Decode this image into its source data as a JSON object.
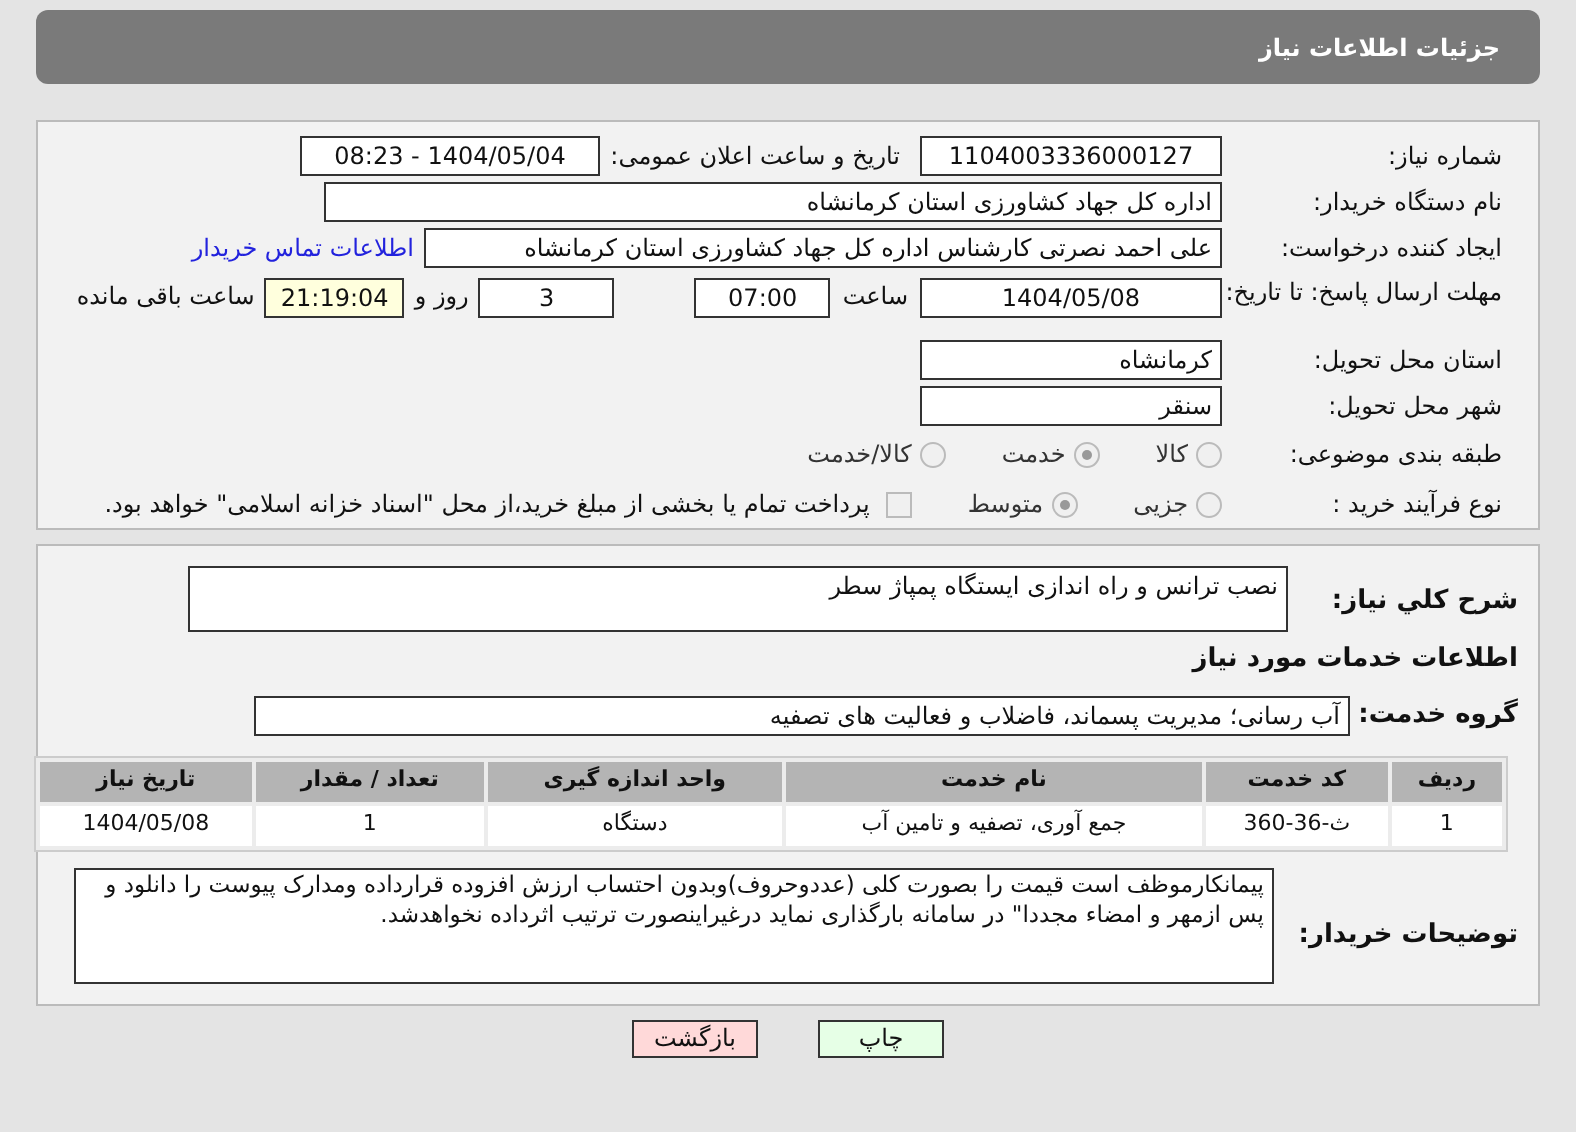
{
  "header": {
    "title": "جزئیات اطلاعات نیاز"
  },
  "need_number": {
    "label": "شماره نیاز:",
    "value": "1104003336000127"
  },
  "announce": {
    "label": "تاریخ و ساعت اعلان عمومی:",
    "value": "1404/05/04 - 08:23"
  },
  "buyer": {
    "label": "نام دستگاه خریدار:",
    "value": "اداره کل جهاد کشاورزی استان کرمانشاه"
  },
  "requester": {
    "label": "ایجاد کننده درخواست:",
    "value": "علی احمد نصرتی کارشناس اداره کل جهاد کشاورزی استان کرمانشاه",
    "link": "اطلاعات تماس خریدار"
  },
  "deadline": {
    "label": "مهلت ارسال پاسخ: تا تاریخ:",
    "date": "1404/05/08",
    "time_label": "ساعت",
    "time": "07:00",
    "days": "3",
    "days_label": "روز و",
    "remaining": "21:19:04",
    "remaining_label": "ساعت باقی مانده"
  },
  "province": {
    "label": "استان محل تحویل:",
    "value": "کرمانشاه"
  },
  "city": {
    "label": "شهر محل تحویل:",
    "value": "سنقر"
  },
  "category": {
    "label": "طبقه بندی موضوعی:",
    "options": [
      {
        "label": "کالا",
        "selected": false
      },
      {
        "label": "خدمت",
        "selected": true
      },
      {
        "label": "کالا/خدمت",
        "selected": false
      }
    ]
  },
  "process": {
    "label": "نوع فرآیند خرید :",
    "options": [
      {
        "label": "جزیی",
        "selected": false
      },
      {
        "label": "متوسط",
        "selected": true
      }
    ],
    "payment": {
      "label": "پرداخت تمام یا بخشی از مبلغ خرید،از محل \"اسناد خزانه اسلامی\" خواهد بود.",
      "checked": false
    }
  },
  "description": {
    "label": "شرح کلي نياز:",
    "value": "نصب ترانس و راه اندازی ایستگاه پمپاژ سطر"
  },
  "services_heading": "اطلاعات خدمات مورد نیاز",
  "service_group": {
    "label": "گروه خدمت:",
    "value": "آب رسانی؛ مدیریت پسماند، فاضلاب و فعالیت های تصفیه"
  },
  "table": {
    "columns": [
      "ردیف",
      "کد خدمت",
      "نام خدمت",
      "واحد اندازه گیری",
      "تعداد / مقدار",
      "تاریخ نیاز"
    ],
    "rows": [
      [
        "1",
        "ث-36-360",
        "جمع آوری، تصفیه و تامین آب",
        "دستگاه",
        "1",
        "1404/05/08"
      ]
    ]
  },
  "buyer_notes": {
    "label": "توضیحات خریدار:",
    "value": "پیمانکارموظف است قیمت را بصورت کلی (عددوحروف)وبدون احتساب ارزش افزوده قرارداده ومدارک پیوست را دانلود و پس ازمهر و امضاء مجددا\"  در سامانه بارگذاری نماید درغیراینصورت ترتیب اثرداده نخواهدشد."
  },
  "buttons": [
    {
      "label": "چاپ",
      "kind": "print"
    },
    {
      "label": "بازگشت",
      "kind": "back"
    }
  ]
}
